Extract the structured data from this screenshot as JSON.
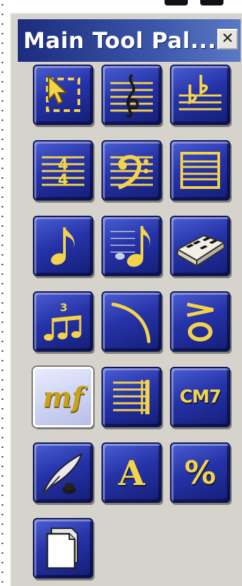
{
  "window": {
    "title": "Main Tool Pal...",
    "close_symbol": "✕"
  },
  "tools": [
    {
      "icon": "selection-tool-icon"
    },
    {
      "icon": "treble-clef-staff-icon"
    },
    {
      "icon": "key-signature-icon"
    },
    {
      "icon": "time-signature-icon"
    },
    {
      "icon": "bass-clef-icon"
    },
    {
      "icon": "staff-icon"
    },
    {
      "icon": "eighth-note-icon"
    },
    {
      "icon": "simple-entry-icon"
    },
    {
      "icon": "keyboard-icon"
    },
    {
      "icon": "tuplet-icon"
    },
    {
      "icon": "slur-icon"
    },
    {
      "icon": "articulation-icon"
    },
    {
      "icon": "expression-icon",
      "label": "mf",
      "selected": true
    },
    {
      "icon": "repeat-icon"
    },
    {
      "icon": "chord-icon",
      "label": "CM7"
    },
    {
      "icon": "lyrics-icon"
    },
    {
      "icon": "text-icon",
      "label": "A"
    },
    {
      "icon": "measure-repeat-icon",
      "label": "%"
    },
    {
      "icon": "page-layout-icon"
    }
  ]
}
